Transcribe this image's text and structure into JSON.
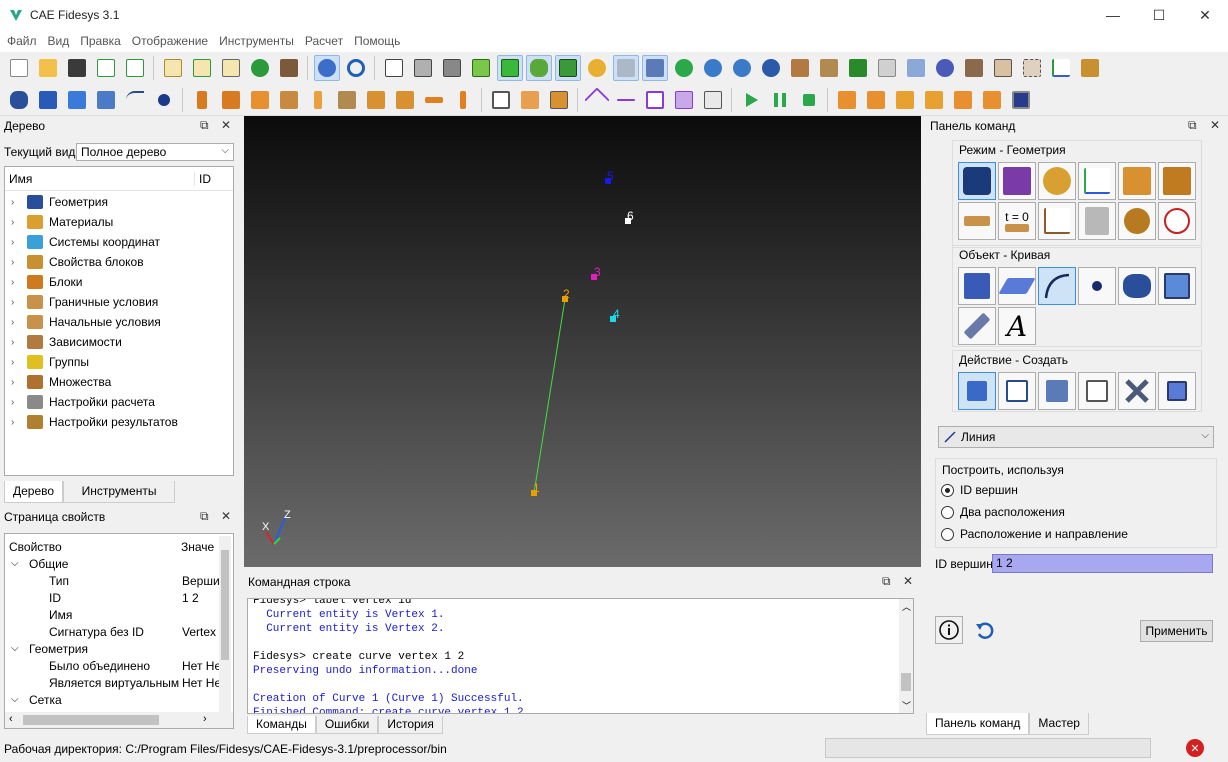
{
  "window": {
    "title": "CAE Fidesys 3.1",
    "minimize": "—",
    "maximize": "☐",
    "close": "✕"
  },
  "menu": [
    "Файл",
    "Вид",
    "Правка",
    "Отображение",
    "Инструменты",
    "Расчет",
    "Помощь"
  ],
  "tree_panel": {
    "title": "Дерево",
    "view_label": "Текущий вид",
    "view_value": "Полное дерево",
    "col_name": "Имя",
    "col_id": "ID",
    "items": [
      {
        "label": "Геометрия",
        "icon": "geometry-icon",
        "color": "#2a4f9a"
      },
      {
        "label": "Материалы",
        "icon": "materials-icon",
        "color": "#d9a030"
      },
      {
        "label": "Системы координат",
        "icon": "coordinate-systems-icon",
        "color": "#3aa0d8"
      },
      {
        "label": "Свойства блоков",
        "icon": "block-properties-icon",
        "color": "#c89030"
      },
      {
        "label": "Блоки",
        "icon": "blocks-icon",
        "color": "#d07a20"
      },
      {
        "label": "Граничные условия",
        "icon": "boundary-conditions-icon",
        "color": "#c8924a"
      },
      {
        "label": "Начальные условия",
        "icon": "initial-conditions-icon",
        "color": "#c8924a"
      },
      {
        "label": "Зависимости",
        "icon": "dependencies-icon",
        "color": "#b07a40"
      },
      {
        "label": "Группы",
        "icon": "groups-icon",
        "color": "#e0c020"
      },
      {
        "label": "Множества",
        "icon": "sets-icon",
        "color": "#b07030"
      },
      {
        "label": "Настройки расчета",
        "icon": "calc-settings-icon",
        "color": "#8a8a8a"
      },
      {
        "label": "Настройки результатов",
        "icon": "result-settings-icon",
        "color": "#b08030"
      }
    ],
    "tabs": [
      "Дерево",
      "Инструменты"
    ]
  },
  "properties_panel": {
    "title": "Страница свойств",
    "col_property": "Свойство",
    "col_value": "Значе",
    "rows": [
      {
        "name": "Общие",
        "value": "",
        "level": 0,
        "group": true
      },
      {
        "name": "Тип",
        "value": "Верши",
        "level": 1,
        "group": false
      },
      {
        "name": "ID",
        "value": "1 2",
        "level": 1,
        "group": false
      },
      {
        "name": "Имя",
        "value": "",
        "level": 1,
        "group": false
      },
      {
        "name": "Сигнатура без ID",
        "value": "Vertex",
        "level": 1,
        "group": false
      },
      {
        "name": "Геометрия",
        "value": "",
        "level": 0,
        "group": true
      },
      {
        "name": "Было объединено",
        "value": "Нет Не",
        "level": 1,
        "group": false
      },
      {
        "name": "Является виртуальным",
        "value": "Нет Не",
        "level": 1,
        "group": false
      },
      {
        "name": "Сетка",
        "value": "",
        "level": 0,
        "group": true
      }
    ]
  },
  "viewport": {
    "vertex_labels": [
      "1",
      "2",
      "3",
      "4",
      "5",
      "6"
    ],
    "axes": {
      "x": "X",
      "y": "Y",
      "z": "Z"
    }
  },
  "command_line": {
    "title": "Командная строка",
    "lines": [
      {
        "text": "Fidesys> label vertex id",
        "style": "black"
      },
      {
        "text": "  Current entity is Vertex 1.",
        "style": "blue"
      },
      {
        "text": "  Current entity is Vertex 2.",
        "style": "blue"
      },
      {
        "text": "",
        "style": "black"
      },
      {
        "text": "Fidesys> create curve vertex 1 2",
        "style": "black"
      },
      {
        "text": "Preserving undo information...done",
        "style": "blue"
      },
      {
        "text": "",
        "style": "black"
      },
      {
        "text": "Creation of Curve 1 (Curve 1) Successful.",
        "style": "blue"
      },
      {
        "text": "Finished Command: create curve vertex 1 2",
        "style": "blue"
      }
    ],
    "tabs": [
      "Команды",
      "Ошибки",
      "История"
    ]
  },
  "command_panel": {
    "title": "Панель команд",
    "mode_label": "Режим - Геометрия",
    "object_label": "Объект - Кривая",
    "action_label": "Действие - Создать",
    "mode_t0": "t = 0",
    "object_text_icon": "A",
    "curve_type": "Линия",
    "build_using_label": "Построить, используя",
    "options": [
      "ID вершин",
      "Два расположения",
      "Расположение и направление"
    ],
    "selected_option": 0,
    "vertex_ids_label": "ID вершин",
    "vertex_ids_value": "1 2",
    "apply_label": "Применить",
    "tabs": [
      "Панель команд",
      "Мастер"
    ]
  },
  "status": {
    "working_dir": "Рабочая директория: C:/Program Files/Fidesys/CAE-Fidesys-3.1/preprocessor/bin"
  }
}
